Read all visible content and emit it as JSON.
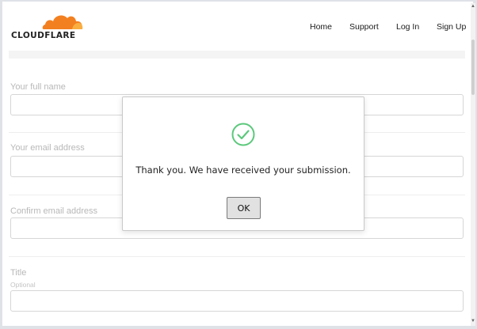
{
  "header": {
    "logo_text": "CLOUDFLARE",
    "nav": [
      {
        "label": "Home"
      },
      {
        "label": "Support"
      },
      {
        "label": "Log In"
      },
      {
        "label": "Sign Up"
      }
    ]
  },
  "form": {
    "fields": [
      {
        "label": "Your full name",
        "value": ""
      },
      {
        "label": "Your email address",
        "value": ""
      },
      {
        "label": "Confirm email address",
        "value": ""
      },
      {
        "label": "Title",
        "hint": "Optional",
        "value": ""
      }
    ]
  },
  "dialog": {
    "icon": "check-circle-icon",
    "message": "Thank you. We have received your submission.",
    "ok_label": "OK"
  },
  "colors": {
    "brand_orange": "#f38020",
    "brand_orange_light": "#faae40",
    "success_green": "#5cc87c"
  }
}
